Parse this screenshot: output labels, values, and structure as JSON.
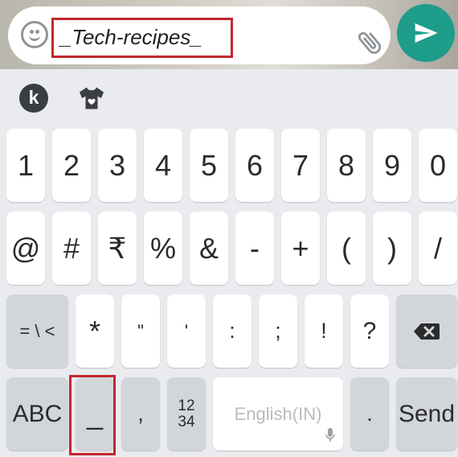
{
  "compose": {
    "message_text": "_Tech-recipes_",
    "emoji_icon": "smiley-icon",
    "attach_icon": "paperclip-icon",
    "send_icon": "send-arrow-icon"
  },
  "toolbar": {
    "keyboard_logo_text": "k",
    "theme_icon": "shirt-icon"
  },
  "keyboard": {
    "row1": [
      "1",
      "2",
      "3",
      "4",
      "5",
      "6",
      "7",
      "8",
      "9",
      "0"
    ],
    "row2": [
      "@",
      "#",
      "₹",
      "%",
      "&",
      "-",
      "+",
      "(",
      ")",
      "/"
    ],
    "row3": {
      "more_symbols": "= \\ <",
      "keys": [
        "*",
        "\"",
        "'",
        ":",
        ";",
        "!",
        "?"
      ],
      "backspace_icon": "backspace-icon"
    },
    "row4": {
      "abc": "ABC",
      "underscore": "_",
      "comma": ",",
      "numpad_top": "12",
      "numpad_bottom": "34",
      "space": "English(IN)",
      "period": ".",
      "send": "Send"
    }
  },
  "colors": {
    "accent_send": "#1d9d8a",
    "highlight": "#c1272d",
    "keyboard_bg": "#e9ebee",
    "function_key": "#d2d6da"
  }
}
